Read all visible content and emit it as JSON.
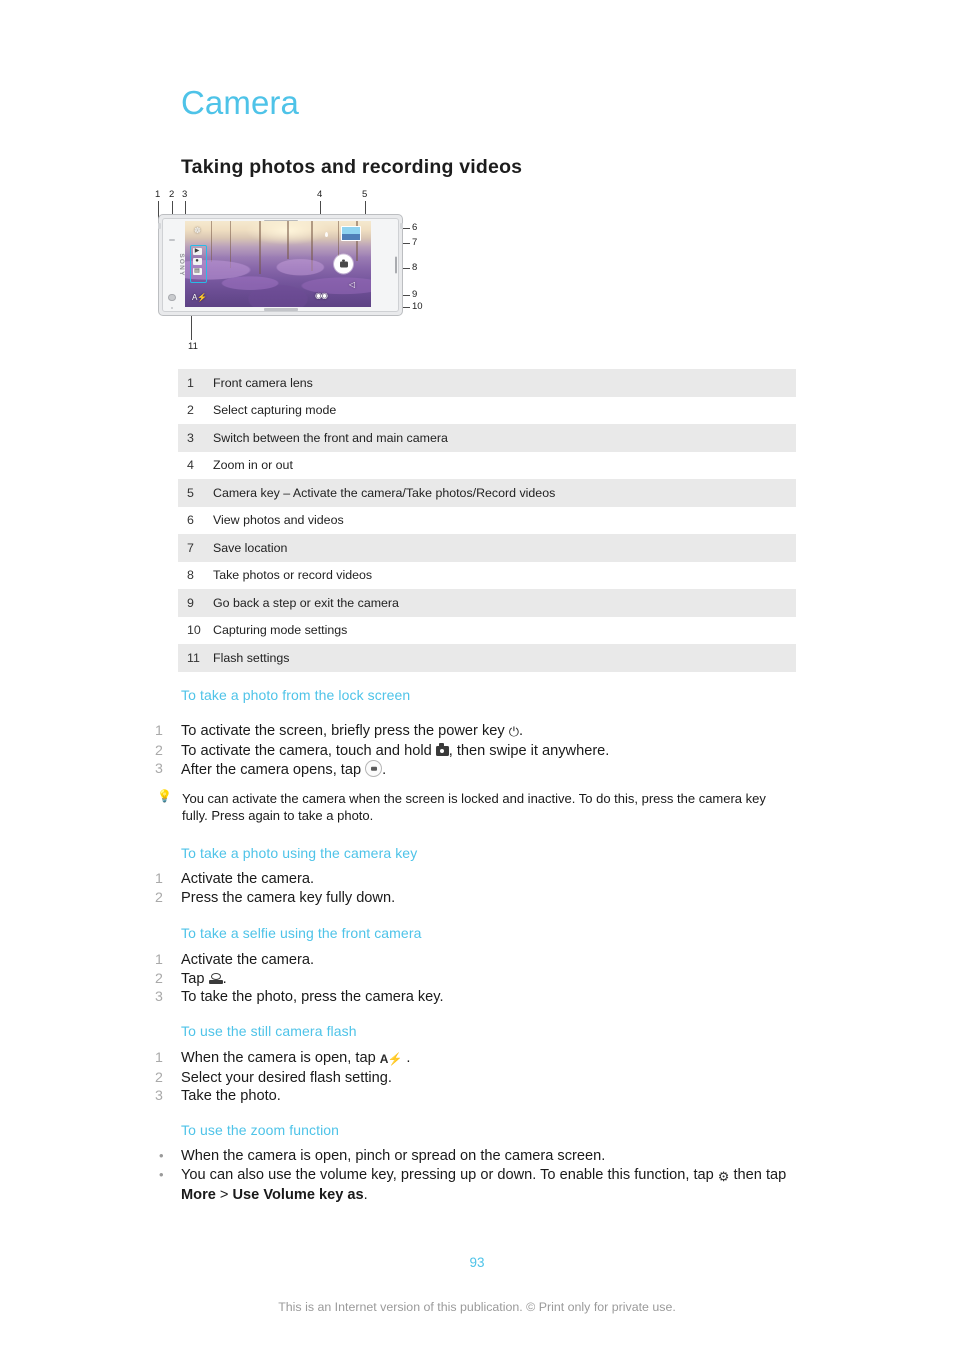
{
  "document": {
    "chapter_title": "Camera",
    "section_heading": "Taking photos and recording videos",
    "page_number": "93",
    "footer_note": "This is an Internet version of this publication. © Print only for private use.",
    "accent_color": "#4ec3e8",
    "highlight_box_color": "#27bbe8",
    "table_alt_row_color": "#e9e9e9"
  },
  "figure": {
    "device_brand": "SONY",
    "callouts_top": [
      "1",
      "2",
      "3",
      "4",
      "5"
    ],
    "callouts_right": [
      "6",
      "7",
      "8",
      "9",
      "10"
    ],
    "callout_bottom": "11"
  },
  "legend": {
    "rows": [
      {
        "num": "1",
        "text": "Front camera lens"
      },
      {
        "num": "2",
        "text": "Select capturing mode"
      },
      {
        "num": "3",
        "text": "Switch between the front and main camera"
      },
      {
        "num": "4",
        "text": "Zoom in or out"
      },
      {
        "num": "5",
        "text": "Camera key – Activate the camera/Take photos/Record videos"
      },
      {
        "num": "6",
        "text": "View photos and videos"
      },
      {
        "num": "7",
        "text": "Save location"
      },
      {
        "num": "8",
        "text": "Take photos or record videos"
      },
      {
        "num": "9",
        "text": "Go back a step or exit the camera"
      },
      {
        "num": "10",
        "text": "Capturing mode settings"
      },
      {
        "num": "11",
        "text": "Flash settings"
      }
    ]
  },
  "procedures": {
    "lock_screen": {
      "heading": "To take a photo from the lock screen",
      "steps": [
        {
          "num": "1",
          "pre": "To activate the screen, briefly press the power key ",
          "icon": "power-icon",
          "post": "."
        },
        {
          "num": "2",
          "pre": "To activate the camera, touch and hold ",
          "icon": "camera-icon",
          "post": ", then swipe it anywhere."
        },
        {
          "num": "3",
          "pre": "After the camera opens, tap ",
          "icon": "camera-circle-icon",
          "post": "."
        }
      ],
      "tip_icon": "lightbulb-icon",
      "tip": "You can activate the camera when the screen is locked and inactive. To do this, press the camera key fully. Press again to take a photo."
    },
    "camera_key": {
      "heading": "To take a photo using the camera key",
      "steps": [
        {
          "num": "1",
          "pre": "Activate the camera.",
          "icon": "",
          "post": ""
        },
        {
          "num": "2",
          "pre": "Press the camera key fully down.",
          "icon": "",
          "post": ""
        }
      ]
    },
    "selfie": {
      "heading": "To take a selfie using the front camera",
      "steps": [
        {
          "num": "1",
          "pre": "Activate the camera.",
          "icon": "",
          "post": ""
        },
        {
          "num": "2",
          "pre": "Tap ",
          "icon": "switch-camera-icon",
          "post": "."
        },
        {
          "num": "3",
          "pre": "To take the photo, press the camera key.",
          "icon": "",
          "post": ""
        }
      ]
    },
    "flash": {
      "heading": "To use the still camera flash",
      "steps": [
        {
          "num": "1",
          "pre": "When the camera is open, tap ",
          "icon": "flash-auto-icon",
          "post": " ."
        },
        {
          "num": "2",
          "pre": "Select your desired flash setting.",
          "icon": "",
          "post": ""
        },
        {
          "num": "3",
          "pre": "Take the photo.",
          "icon": "",
          "post": ""
        }
      ]
    },
    "zoom": {
      "heading": "To use the zoom function",
      "bullets": [
        {
          "num": "•",
          "pre": "When the camera is open, pinch or spread on the camera screen.",
          "icon": "",
          "post": ""
        },
        {
          "num": "•",
          "pre": "You can also use the volume key, pressing up or down. To enable this function, tap ",
          "icon": "gear-icon",
          "post": " then tap ",
          "bold1": "More",
          "mid": " > ",
          "bold2": "Use Volume key as",
          "tail": "."
        }
      ]
    }
  }
}
